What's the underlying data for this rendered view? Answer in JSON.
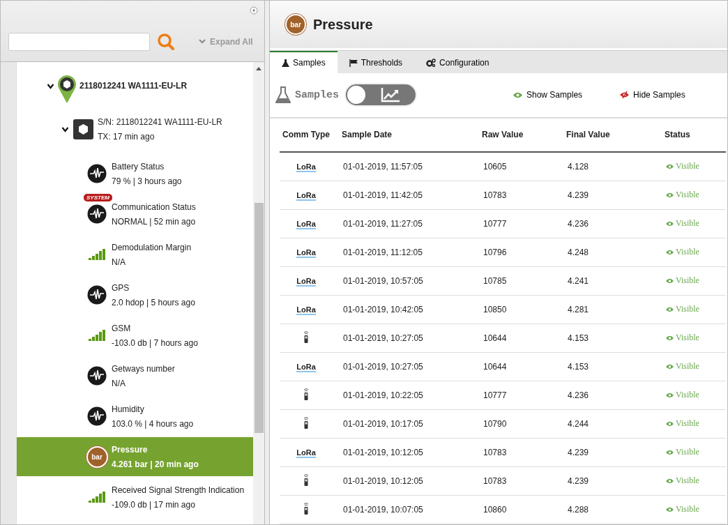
{
  "sidebar": {
    "expand_all": "Expand All",
    "tree": [
      {
        "label": "2118012241 WA1111-EU-LR",
        "expanded": true,
        "children": [
          {
            "label": "S/N: 2118012241 WA1111-EU-LR",
            "detail": "TX: 17 min ago",
            "expanded": true,
            "children": [
              {
                "kind": "wave",
                "name": "Battery Status",
                "value": "79 % | 3 hours ago",
                "selected": false
              },
              {
                "kind": "wave",
                "name": "Communication Status",
                "value": "NORMAL | 52 min ago",
                "badge": "SYSTEM",
                "selected": false
              },
              {
                "kind": "signal",
                "name": "Demodulation Margin",
                "value": "N/A",
                "selected": false
              },
              {
                "kind": "wave",
                "name": "GPS",
                "value": "2.0 hdop | 5 hours ago",
                "selected": false
              },
              {
                "kind": "signal",
                "name": "GSM",
                "value": "-103.0 db | 7 hours ago",
                "selected": false
              },
              {
                "kind": "wave",
                "name": "Getways number",
                "value": "N/A",
                "selected": false
              },
              {
                "kind": "wave",
                "name": "Humidity",
                "value": "103.0 % | 4 hours ago",
                "selected": false
              },
              {
                "kind": "unit",
                "unit": "bar",
                "name": "Pressure",
                "value": "4.261 bar | 20 min ago",
                "selected": true
              },
              {
                "kind": "signal",
                "name": "Received Signal Strength Indication",
                "value": "-109.0 db | 17 min ago",
                "selected": false
              }
            ]
          }
        ]
      }
    ]
  },
  "header": {
    "unit": "bar",
    "title": "Pressure"
  },
  "tabs": [
    {
      "label": "Samples",
      "kind": "flask",
      "selected": true
    },
    {
      "label": "Thresholds",
      "kind": "flag",
      "selected": false
    },
    {
      "label": "Configuration",
      "kind": "gears",
      "selected": false
    }
  ],
  "toolbar": {
    "label": "Samples",
    "chart_view": false,
    "show": "Show Samples",
    "hide": "Hide Samples"
  },
  "table": {
    "columns": [
      "Comm Type",
      "Sample Date",
      "Raw Value",
      "Final Value",
      "Status"
    ],
    "rows": [
      {
        "comm": {
          "kind": "lora",
          "label": "LoRa"
        },
        "date": "01-01-2019, 11:57:05",
        "raw": "10605",
        "final": "4.128",
        "status": "Visible"
      },
      {
        "comm": {
          "kind": "lora",
          "label": "LoRa"
        },
        "date": "01-01-2019, 11:42:05",
        "raw": "10783",
        "final": "4.239",
        "status": "Visible"
      },
      {
        "comm": {
          "kind": "lora",
          "label": "LoRa"
        },
        "date": "01-01-2019, 11:27:05",
        "raw": "10777",
        "final": "4.236",
        "status": "Visible"
      },
      {
        "comm": {
          "kind": "lora",
          "label": "LoRa"
        },
        "date": "01-01-2019, 11:12:05",
        "raw": "10796",
        "final": "4.248",
        "status": "Visible"
      },
      {
        "comm": {
          "kind": "lora",
          "label": "LoRa"
        },
        "date": "01-01-2019, 10:57:05",
        "raw": "10785",
        "final": "4.241",
        "status": "Visible"
      },
      {
        "comm": {
          "kind": "lora",
          "label": "LoRa"
        },
        "date": "01-01-2019, 10:42:05",
        "raw": "10850",
        "final": "4.281",
        "status": "Visible"
      },
      {
        "comm": {
          "kind": "cellular"
        },
        "date": "01-01-2019, 10:27:05",
        "raw": "10644",
        "final": "4.153",
        "status": "Visible"
      },
      {
        "comm": {
          "kind": "lora",
          "label": "LoRa"
        },
        "date": "01-01-2019, 10:27:05",
        "raw": "10644",
        "final": "4.153",
        "status": "Visible"
      },
      {
        "comm": {
          "kind": "cellular"
        },
        "date": "01-01-2019, 10:22:05",
        "raw": "10777",
        "final": "4.236",
        "status": "Visible"
      },
      {
        "comm": {
          "kind": "cellular"
        },
        "date": "01-01-2019, 10:17:05",
        "raw": "10790",
        "final": "4.244",
        "status": "Visible"
      },
      {
        "comm": {
          "kind": "lora",
          "label": "LoRa"
        },
        "date": "01-01-2019, 10:12:05",
        "raw": "10783",
        "final": "4.239",
        "status": "Visible"
      },
      {
        "comm": {
          "kind": "cellular"
        },
        "date": "01-01-2019, 10:12:05",
        "raw": "10783",
        "final": "4.239",
        "status": "Visible"
      },
      {
        "comm": {
          "kind": "cellular"
        },
        "date": "01-01-2019, 10:07:05",
        "raw": "10860",
        "final": "4.288",
        "status": "Visible"
      }
    ]
  }
}
